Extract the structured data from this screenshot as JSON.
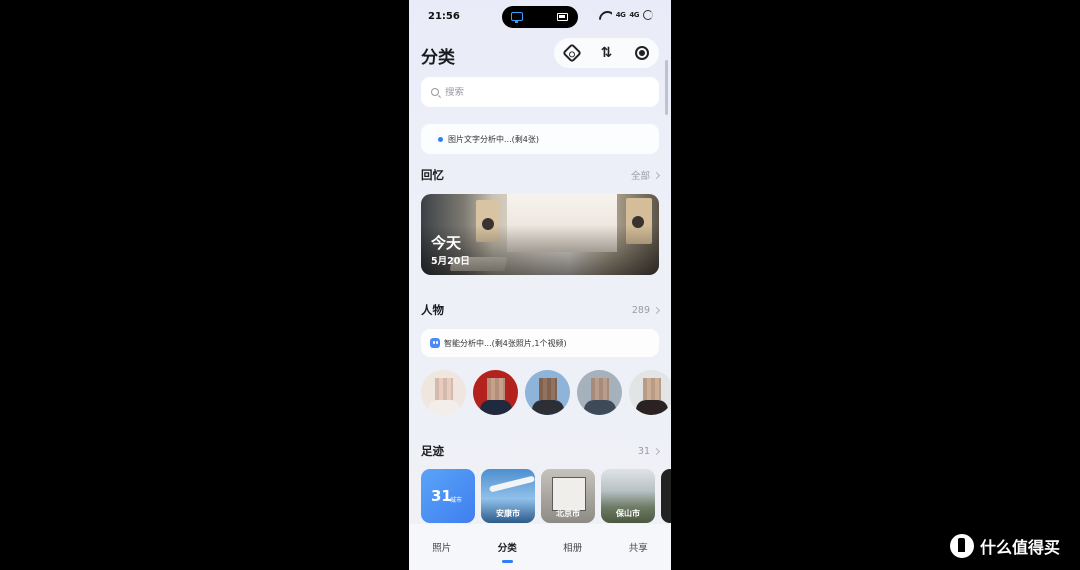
{
  "status": {
    "time": "21:56",
    "signal1": "4G",
    "signal2": "4G"
  },
  "header": {
    "title": "分类",
    "icons": [
      "settings-icon",
      "sort-icon",
      "record-icon"
    ]
  },
  "search": {
    "placeholder": "搜索"
  },
  "analysis": {
    "text": "图片文字分析中...(剩4张)"
  },
  "memories": {
    "title": "回忆",
    "more_label": "全部",
    "card": {
      "title": "今天",
      "date": "5月20日"
    }
  },
  "people": {
    "title": "人物",
    "count": "289",
    "ai_text": "智能分析中...(剩4张照片,1个视频)",
    "avatars": 5
  },
  "places": {
    "title": "足迹",
    "count": "31",
    "city_count": "31",
    "city_unit": "城市",
    "items": [
      {
        "label": "安康市"
      },
      {
        "label": "北京市"
      },
      {
        "label": "保山市"
      }
    ]
  },
  "tabs": [
    {
      "label": "照片",
      "active": false
    },
    {
      "label": "分类",
      "active": true
    },
    {
      "label": "相册",
      "active": false
    },
    {
      "label": "共享",
      "active": false
    }
  ],
  "watermark": {
    "text": "什么值得买"
  },
  "colors": {
    "accent": "#2f7ff6",
    "background": "#000000",
    "panel": "#eef0f8"
  }
}
